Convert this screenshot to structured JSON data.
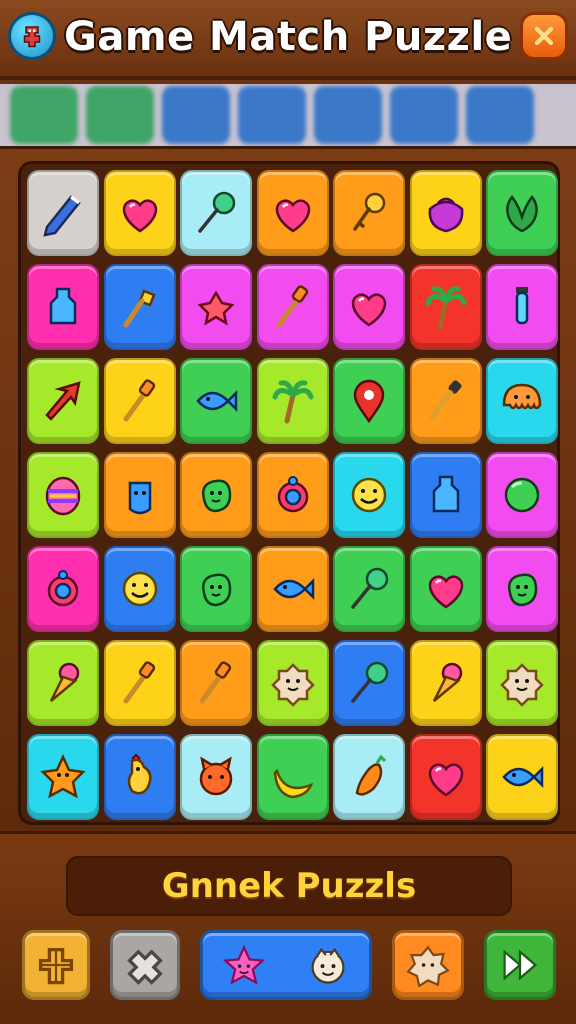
{
  "header": {
    "title": "Game Match Puzzle",
    "left_icon": "totem-icon",
    "close_icon": "close-icon"
  },
  "colors": {
    "header_bg": "#7a3d16",
    "board_bg": "#4a220c",
    "banner_text": "#ffd43b",
    "tile_gray": "#d6d0cc",
    "tile_yellow": "#ffd21a",
    "tile_lightblue": "#a8ecf5",
    "tile_orange": "#ff9c1a",
    "tile_pink": "#ff2fb0",
    "tile_blue": "#2f7df2",
    "tile_magenta": "#f24bf0",
    "tile_red": "#f2342a",
    "tile_lime": "#a6e82a",
    "tile_green": "#3fcf54",
    "tile_cyan": "#2ad8ee"
  },
  "board": {
    "rows": [
      [
        {
          "c": "gray",
          "i": "pencil-icon"
        },
        {
          "c": "yellow",
          "i": "heart-icon"
        },
        {
          "c": "lightblue",
          "i": "lollipop-icon"
        },
        {
          "c": "orange",
          "i": "heart-icon"
        },
        {
          "c": "orange",
          "i": "key-icon"
        },
        {
          "c": "yellow",
          "i": "bag-icon"
        },
        {
          "c": "green",
          "i": "leaf-icon"
        }
      ],
      [
        {
          "c": "pink",
          "i": "bottle-icon"
        },
        {
          "c": "blue",
          "i": "torch-icon"
        },
        {
          "c": "magenta",
          "i": "flower-icon"
        },
        {
          "c": "magenta",
          "i": "brush-icon"
        },
        {
          "c": "magenta",
          "i": "heart-icon"
        },
        {
          "c": "red",
          "i": "palm-tree-icon"
        },
        {
          "c": "magenta",
          "i": "vial-icon"
        }
      ],
      [
        {
          "c": "lime",
          "i": "arrow-icon"
        },
        {
          "c": "yellow",
          "i": "brush-icon"
        },
        {
          "c": "green",
          "i": "fish-icon"
        },
        {
          "c": "lime",
          "i": "palm-tree-icon"
        },
        {
          "c": "green",
          "i": "map-pin-icon"
        },
        {
          "c": "orange",
          "i": "dropper-icon"
        },
        {
          "c": "cyan",
          "i": "jellyfish-icon"
        }
      ],
      [
        {
          "c": "lime",
          "i": "easter-egg-icon"
        },
        {
          "c": "orange",
          "i": "creature-icon"
        },
        {
          "c": "orange",
          "i": "bean-icon"
        },
        {
          "c": "orange",
          "i": "camera-icon"
        },
        {
          "c": "cyan",
          "i": "smiley-icon"
        },
        {
          "c": "blue",
          "i": "bottle-icon"
        },
        {
          "c": "magenta",
          "i": "ball-icon"
        }
      ],
      [
        {
          "c": "pink",
          "i": "camera-icon"
        },
        {
          "c": "blue",
          "i": "smiley-icon"
        },
        {
          "c": "green",
          "i": "bean-icon"
        },
        {
          "c": "orange",
          "i": "fish-icon"
        },
        {
          "c": "green",
          "i": "lollipop-icon"
        },
        {
          "c": "green",
          "i": "heart-icon"
        },
        {
          "c": "magenta",
          "i": "bean-icon"
        }
      ],
      [
        {
          "c": "lime",
          "i": "ice-cream-icon"
        },
        {
          "c": "yellow",
          "i": "brush-icon"
        },
        {
          "c": "orange",
          "i": "brush-icon"
        },
        {
          "c": "lime",
          "i": "cookie-icon"
        },
        {
          "c": "blue",
          "i": "lollipop-icon"
        },
        {
          "c": "yellow",
          "i": "ice-cream-icon"
        },
        {
          "c": "lime",
          "i": "cookie-icon"
        }
      ],
      [
        {
          "c": "cyan",
          "i": "star-icon"
        },
        {
          "c": "blue",
          "i": "chicken-icon"
        },
        {
          "c": "lightblue",
          "i": "cat-icon"
        },
        {
          "c": "green",
          "i": "banana-icon"
        },
        {
          "c": "lightblue",
          "i": "carrot-icon"
        },
        {
          "c": "red",
          "i": "heart-icon"
        },
        {
          "c": "yellow",
          "i": "fish-icon"
        }
      ]
    ]
  },
  "footer": {
    "banner_text": "Gnnek Puzzls",
    "buttons": [
      {
        "name": "totem-button",
        "icon": "totem-icon",
        "color": "#f2b233"
      },
      {
        "name": "puzzle-button",
        "icon": "puzzle-icon",
        "color": "#a9a6a3"
      },
      {
        "name": "characters-button",
        "icon": "star-icon",
        "color": "#2f80f5"
      },
      {
        "name": "cookie-button",
        "icon": "cookie-icon",
        "color": "#ff8a1f"
      },
      {
        "name": "next-button",
        "icon": "fast-forward-icon",
        "color": "#3fb53a"
      }
    ]
  }
}
